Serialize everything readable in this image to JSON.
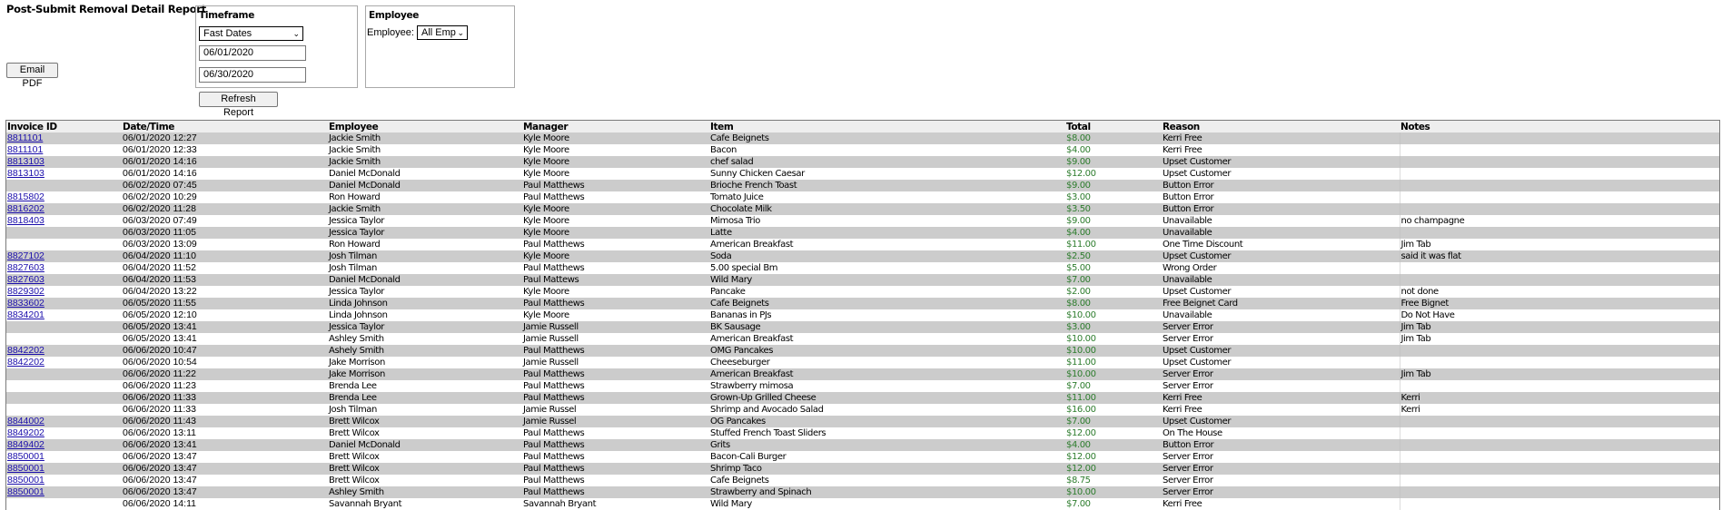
{
  "page": {
    "title": "Post-Submit Removal Detail Report",
    "email_pdf_label": "Email PDF",
    "refresh_label": "Refresh Report"
  },
  "timeframe": {
    "legend": "Timeframe",
    "preset": "Fast Dates",
    "start_date": "06/01/2020",
    "end_date": "06/30/2020"
  },
  "employee_filter": {
    "legend": "Employee",
    "label": "Employee:",
    "selected": "All Emp"
  },
  "table": {
    "columns": [
      "Invoice ID",
      "Date/Time",
      "Employee",
      "Manager",
      "Item",
      "Total",
      "Reason",
      "Notes"
    ],
    "rows": [
      {
        "invoice": "8811101",
        "datetime": "06/01/2020 12:27",
        "employee": "Jackie Smith",
        "manager": "Kyle Moore",
        "item": "Cafe Beignets",
        "total": "$8.00",
        "reason": "Kerri Free",
        "notes": ""
      },
      {
        "invoice": "8811101",
        "datetime": "06/01/2020 12:33",
        "employee": "Jackie Smith",
        "manager": "Kyle Moore",
        "item": "Bacon",
        "total": "$4.00",
        "reason": "Kerri Free",
        "notes": ""
      },
      {
        "invoice": "8813103",
        "datetime": "06/01/2020 14:16",
        "employee": "Jackie Smith",
        "manager": "Kyle Moore",
        "item": "chef salad",
        "total": "$9.00",
        "reason": "Upset Customer",
        "notes": ""
      },
      {
        "invoice": "8813103",
        "datetime": "06/01/2020 14:16",
        "employee": "Daniel McDonald",
        "manager": "Kyle Moore",
        "item": "Sunny Chicken Caesar",
        "total": "$12.00",
        "reason": "Upset Customer",
        "notes": ""
      },
      {
        "invoice": "",
        "datetime": "06/02/2020 07:45",
        "employee": "Daniel McDonald",
        "manager": "Paul Matthews",
        "item": "Brioche French Toast",
        "total": "$9.00",
        "reason": "Button Error",
        "notes": ""
      },
      {
        "invoice": "8815802",
        "datetime": "06/02/2020 10:29",
        "employee": "Ron Howard",
        "manager": "Paul Matthews",
        "item": "Tomato Juice",
        "total": "$3.00",
        "reason": "Button Error",
        "notes": ""
      },
      {
        "invoice": "8816202",
        "datetime": "06/02/2020 11:28",
        "employee": "Jackie Smith",
        "manager": "Kyle Moore",
        "item": "Chocolate Milk",
        "total": "$3.50",
        "reason": "Button Error",
        "notes": ""
      },
      {
        "invoice": "8818403",
        "datetime": "06/03/2020 07:49",
        "employee": "Jessica Taylor",
        "manager": "Kyle Moore",
        "item": "Mimosa Trio",
        "total": "$9.00",
        "reason": "Unavailable",
        "notes": "no champagne"
      },
      {
        "invoice": "",
        "datetime": "06/03/2020 11:05",
        "employee": "Jessica Taylor",
        "manager": "Kyle Moore",
        "item": "Latte",
        "total": "$4.00",
        "reason": "Unavailable",
        "notes": ""
      },
      {
        "invoice": "",
        "datetime": "06/03/2020 13:09",
        "employee": "Ron Howard",
        "manager": "Paul Matthews",
        "item": "American Breakfast",
        "total": "$11.00",
        "reason": "One Time Discount",
        "notes": "Jim Tab"
      },
      {
        "invoice": "8827102",
        "datetime": "06/04/2020 11:10",
        "employee": "Josh Tilman",
        "manager": "Kyle Moore",
        "item": "Soda",
        "total": "$2.50",
        "reason": "Upset Customer",
        "notes": "said it was flat"
      },
      {
        "invoice": "8827603",
        "datetime": "06/04/2020 11:52",
        "employee": "Josh Tilman",
        "manager": "Paul Matthews",
        "item": "5.00 special Bm",
        "total": "$5.00",
        "reason": "Wrong Order",
        "notes": ""
      },
      {
        "invoice": "8827603",
        "datetime": "06/04/2020 11:53",
        "employee": "Daniel McDonald",
        "manager": "Paul Mattews",
        "item": "Wild Mary",
        "total": "$7.00",
        "reason": "Unavailable",
        "notes": ""
      },
      {
        "invoice": "8829302",
        "datetime": "06/04/2020 13:22",
        "employee": "Jessica Taylor",
        "manager": "Kyle Moore",
        "item": "Pancake",
        "total": "$2.00",
        "reason": "Upset Customer",
        "notes": "not done"
      },
      {
        "invoice": "8833602",
        "datetime": "06/05/2020 11:55",
        "employee": "Linda Johnson",
        "manager": "Paul Matthews",
        "item": "Cafe Beignets",
        "total": "$8.00",
        "reason": "Free Beignet Card",
        "notes": "Free Bignet"
      },
      {
        "invoice": "8834201",
        "datetime": "06/05/2020 12:10",
        "employee": "Linda Johnson",
        "manager": "Kyle Moore",
        "item": "Bananas in PJs",
        "total": "$10.00",
        "reason": "Unavailable",
        "notes": "Do Not Have"
      },
      {
        "invoice": "",
        "datetime": "06/05/2020 13:41",
        "employee": "Jessica Taylor",
        "manager": "Jamie Russell",
        "item": "BK Sausage",
        "total": "$3.00",
        "reason": "Server Error",
        "notes": "Jim Tab"
      },
      {
        "invoice": "",
        "datetime": "06/05/2020 13:41",
        "employee": "Ashley Smith",
        "manager": "Jamie Russell",
        "item": "American Breakfast",
        "total": "$10.00",
        "reason": "Server Error",
        "notes": "Jim Tab"
      },
      {
        "invoice": "8842202",
        "datetime": "06/06/2020 10:47",
        "employee": "Ashely Smith",
        "manager": "Paul Matthews",
        "item": "OMG Pancakes",
        "total": "$10.00",
        "reason": "Upset Customer",
        "notes": ""
      },
      {
        "invoice": "8842202",
        "datetime": "06/06/2020 10:54",
        "employee": "Jake Morrison",
        "manager": "Jamie Russell",
        "item": "Cheeseburger",
        "total": "$11.00",
        "reason": "Upset Customer",
        "notes": ""
      },
      {
        "invoice": "",
        "datetime": "06/06/2020 11:22",
        "employee": "Jake Morrison",
        "manager": "Paul Matthews",
        "item": "American Breakfast",
        "total": "$10.00",
        "reason": "Server Error",
        "notes": "Jim Tab"
      },
      {
        "invoice": "",
        "datetime": "06/06/2020 11:23",
        "employee": "Brenda Lee",
        "manager": "Paul Matthews",
        "item": "Strawberry mimosa",
        "total": "$7.00",
        "reason": "Server Error",
        "notes": ""
      },
      {
        "invoice": "",
        "datetime": "06/06/2020 11:33",
        "employee": "Brenda Lee",
        "manager": "Paul Matthews",
        "item": "Grown-Up Grilled Cheese",
        "total": "$11.00",
        "reason": "Kerri Free",
        "notes": "Kerri"
      },
      {
        "invoice": "",
        "datetime": "06/06/2020 11:33",
        "employee": "Josh Tilman",
        "manager": "Jamie Russel",
        "item": "Shrimp and Avocado Salad",
        "total": "$16.00",
        "reason": "Kerri Free",
        "notes": "Kerri"
      },
      {
        "invoice": "8844002",
        "datetime": "06/06/2020 11:43",
        "employee": "Brett Wilcox",
        "manager": "Jamie Russel",
        "item": "OG Pancakes",
        "total": "$7.00",
        "reason": "Upset Customer",
        "notes": ""
      },
      {
        "invoice": "8849202",
        "datetime": "06/06/2020 13:11",
        "employee": "Brett Wilcox",
        "manager": "Paul Matthews",
        "item": "Stuffed French Toast Sliders",
        "total": "$12.00",
        "reason": "On The House",
        "notes": ""
      },
      {
        "invoice": "8849402",
        "datetime": "06/06/2020 13:41",
        "employee": "Daniel McDonald",
        "manager": "Paul Matthews",
        "item": "Grits",
        "total": "$4.00",
        "reason": "Button Error",
        "notes": ""
      },
      {
        "invoice": "8850001",
        "datetime": "06/06/2020 13:47",
        "employee": "Brett Wilcox",
        "manager": "Paul Matthews",
        "item": "Bacon-Cali Burger",
        "total": "$12.00",
        "reason": "Server Error",
        "notes": ""
      },
      {
        "invoice": "8850001",
        "datetime": "06/06/2020 13:47",
        "employee": "Brett Wilcox",
        "manager": "Paul Matthews",
        "item": "Shrimp Taco",
        "total": "$12.00",
        "reason": "Server Error",
        "notes": ""
      },
      {
        "invoice": "8850001",
        "datetime": "06/06/2020 13:47",
        "employee": "Brett Wilcox",
        "manager": "Paul Matthews",
        "item": "Cafe Beignets",
        "total": "$8.75",
        "reason": "Server Error",
        "notes": ""
      },
      {
        "invoice": "8850001",
        "datetime": "06/06/2020 13:47",
        "employee": "Ashley Smith",
        "manager": "Paul Matthews",
        "item": "Strawberry and Spinach",
        "total": "$10.00",
        "reason": "Server Error",
        "notes": ""
      },
      {
        "invoice": "",
        "datetime": "06/06/2020 14:11",
        "employee": "Savannah Bryant",
        "manager": "Savannah Bryant",
        "item": "Wild Mary",
        "total": "$7.00",
        "reason": "Kerri Free",
        "notes": ""
      }
    ]
  },
  "colors": {
    "link": "#1a0dab",
    "total_text": "#2e7d2e",
    "row_alt": "#cccccc",
    "header_bg": "#eeeeee"
  }
}
